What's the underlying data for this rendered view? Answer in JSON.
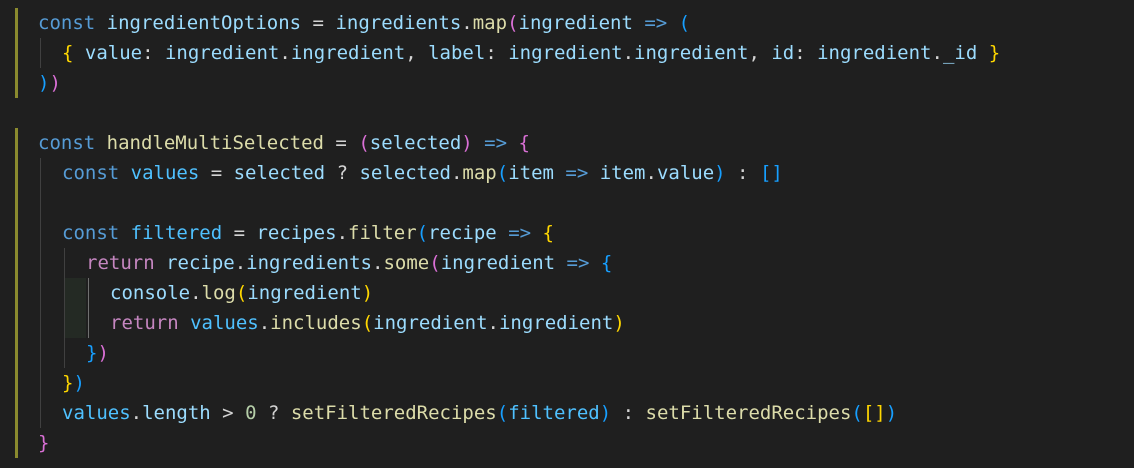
{
  "editor": {
    "colors": {
      "background": "#1f1f1f",
      "keyword": "#569cd6",
      "variable": "#9cdcfe",
      "function": "#dcdcaa",
      "control": "#c586c0",
      "bracket_1": "#ffd700",
      "bracket_2": "#da70d6",
      "bracket_3": "#179fff"
    },
    "lines": [
      {
        "indent": 0,
        "tokens": [
          {
            "text": "const ",
            "type": "keyword"
          },
          {
            "text": "ingredientOptions",
            "type": "variable"
          },
          {
            "text": " = ",
            "type": "operator"
          },
          {
            "text": "ingredients",
            "type": "variable"
          },
          {
            "text": ".",
            "type": "punct"
          },
          {
            "text": "map",
            "type": "function"
          },
          {
            "text": "(",
            "type": "b2"
          },
          {
            "text": "ingredient",
            "type": "variable"
          },
          {
            "text": " => ",
            "type": "arrow"
          },
          {
            "text": "(",
            "type": "b3"
          }
        ]
      },
      {
        "indent": 1,
        "tokens": [
          {
            "text": "{ ",
            "type": "b1"
          },
          {
            "text": "value",
            "type": "variable"
          },
          {
            "text": ": ",
            "type": "punct"
          },
          {
            "text": "ingredient",
            "type": "variable"
          },
          {
            "text": ".",
            "type": "punct"
          },
          {
            "text": "ingredient",
            "type": "variable"
          },
          {
            "text": ", ",
            "type": "punct"
          },
          {
            "text": "label",
            "type": "variable"
          },
          {
            "text": ": ",
            "type": "punct"
          },
          {
            "text": "ingredient",
            "type": "variable"
          },
          {
            "text": ".",
            "type": "punct"
          },
          {
            "text": "ingredient",
            "type": "variable"
          },
          {
            "text": ", ",
            "type": "punct"
          },
          {
            "text": "id",
            "type": "variable"
          },
          {
            "text": ": ",
            "type": "punct"
          },
          {
            "text": "ingredient",
            "type": "variable"
          },
          {
            "text": ".",
            "type": "punct"
          },
          {
            "text": "_id",
            "type": "variable"
          },
          {
            "text": " }",
            "type": "b1"
          }
        ]
      },
      {
        "indent": 0,
        "tokens": [
          {
            "text": ")",
            "type": "b3"
          },
          {
            "text": ")",
            "type": "b2"
          }
        ]
      },
      {
        "indent": 0,
        "tokens": []
      },
      {
        "indent": 0,
        "tokens": [
          {
            "text": "const ",
            "type": "keyword"
          },
          {
            "text": "handleMultiSelected",
            "type": "function"
          },
          {
            "text": " = ",
            "type": "operator"
          },
          {
            "text": "(",
            "type": "b2"
          },
          {
            "text": "selected",
            "type": "variable"
          },
          {
            "text": ")",
            "type": "b2"
          },
          {
            "text": " => ",
            "type": "arrow"
          },
          {
            "text": "{",
            "type": "b2"
          }
        ]
      },
      {
        "indent": 1,
        "tokens": [
          {
            "text": "const ",
            "type": "keyword"
          },
          {
            "text": "values",
            "type": "const"
          },
          {
            "text": " = ",
            "type": "operator"
          },
          {
            "text": "selected",
            "type": "variable"
          },
          {
            "text": " ? ",
            "type": "operator"
          },
          {
            "text": "selected",
            "type": "variable"
          },
          {
            "text": ".",
            "type": "punct"
          },
          {
            "text": "map",
            "type": "function"
          },
          {
            "text": "(",
            "type": "b3"
          },
          {
            "text": "item",
            "type": "variable"
          },
          {
            "text": " => ",
            "type": "arrow"
          },
          {
            "text": "item",
            "type": "variable"
          },
          {
            "text": ".",
            "type": "punct"
          },
          {
            "text": "value",
            "type": "variable"
          },
          {
            "text": ")",
            "type": "b3"
          },
          {
            "text": " : ",
            "type": "operator"
          },
          {
            "text": "[]",
            "type": "b3"
          }
        ]
      },
      {
        "indent": 1,
        "tokens": []
      },
      {
        "indent": 1,
        "tokens": [
          {
            "text": "const ",
            "type": "keyword"
          },
          {
            "text": "filtered",
            "type": "const"
          },
          {
            "text": " = ",
            "type": "operator"
          },
          {
            "text": "recipes",
            "type": "variable"
          },
          {
            "text": ".",
            "type": "punct"
          },
          {
            "text": "filter",
            "type": "function"
          },
          {
            "text": "(",
            "type": "b3"
          },
          {
            "text": "recipe",
            "type": "variable"
          },
          {
            "text": " => ",
            "type": "arrow"
          },
          {
            "text": "{",
            "type": "b1"
          }
        ]
      },
      {
        "indent": 2,
        "tokens": [
          {
            "text": "return ",
            "type": "return"
          },
          {
            "text": "recipe",
            "type": "variable"
          },
          {
            "text": ".",
            "type": "punct"
          },
          {
            "text": "ingredients",
            "type": "variable"
          },
          {
            "text": ".",
            "type": "punct"
          },
          {
            "text": "some",
            "type": "function"
          },
          {
            "text": "(",
            "type": "b2"
          },
          {
            "text": "ingredient",
            "type": "variable"
          },
          {
            "text": " => ",
            "type": "arrow"
          },
          {
            "text": "{",
            "type": "b3"
          }
        ]
      },
      {
        "indent": 3,
        "tokens": [
          {
            "text": "console",
            "type": "variable"
          },
          {
            "text": ".",
            "type": "punct"
          },
          {
            "text": "log",
            "type": "function"
          },
          {
            "text": "(",
            "type": "b1"
          },
          {
            "text": "ingredient",
            "type": "variable"
          },
          {
            "text": ")",
            "type": "b1"
          }
        ]
      },
      {
        "indent": 3,
        "tokens": [
          {
            "text": "return ",
            "type": "return"
          },
          {
            "text": "values",
            "type": "const"
          },
          {
            "text": ".",
            "type": "punct"
          },
          {
            "text": "includes",
            "type": "function"
          },
          {
            "text": "(",
            "type": "b1"
          },
          {
            "text": "ingredient",
            "type": "variable"
          },
          {
            "text": ".",
            "type": "punct"
          },
          {
            "text": "ingredient",
            "type": "variable"
          },
          {
            "text": ")",
            "type": "b1"
          }
        ]
      },
      {
        "indent": 2,
        "tokens": [
          {
            "text": "}",
            "type": "b3"
          },
          {
            "text": ")",
            "type": "b2"
          }
        ]
      },
      {
        "indent": 1,
        "tokens": [
          {
            "text": "}",
            "type": "b1"
          },
          {
            "text": ")",
            "type": "b3"
          }
        ]
      },
      {
        "indent": 1,
        "tokens": [
          {
            "text": "values",
            "type": "const"
          },
          {
            "text": ".",
            "type": "punct"
          },
          {
            "text": "length",
            "type": "variable"
          },
          {
            "text": " > ",
            "type": "operator"
          },
          {
            "text": "0",
            "type": "number"
          },
          {
            "text": " ? ",
            "type": "operator"
          },
          {
            "text": "setFilteredRecipes",
            "type": "function"
          },
          {
            "text": "(",
            "type": "b3"
          },
          {
            "text": "filtered",
            "type": "const"
          },
          {
            "text": ")",
            "type": "b3"
          },
          {
            "text": " : ",
            "type": "operator"
          },
          {
            "text": "setFilteredRecipes",
            "type": "function"
          },
          {
            "text": "(",
            "type": "b3"
          },
          {
            "text": "[]",
            "type": "b1"
          },
          {
            "text": ")",
            "type": "b3"
          }
        ]
      },
      {
        "indent": 0,
        "tokens": [
          {
            "text": "}",
            "type": "b2"
          }
        ]
      }
    ]
  }
}
